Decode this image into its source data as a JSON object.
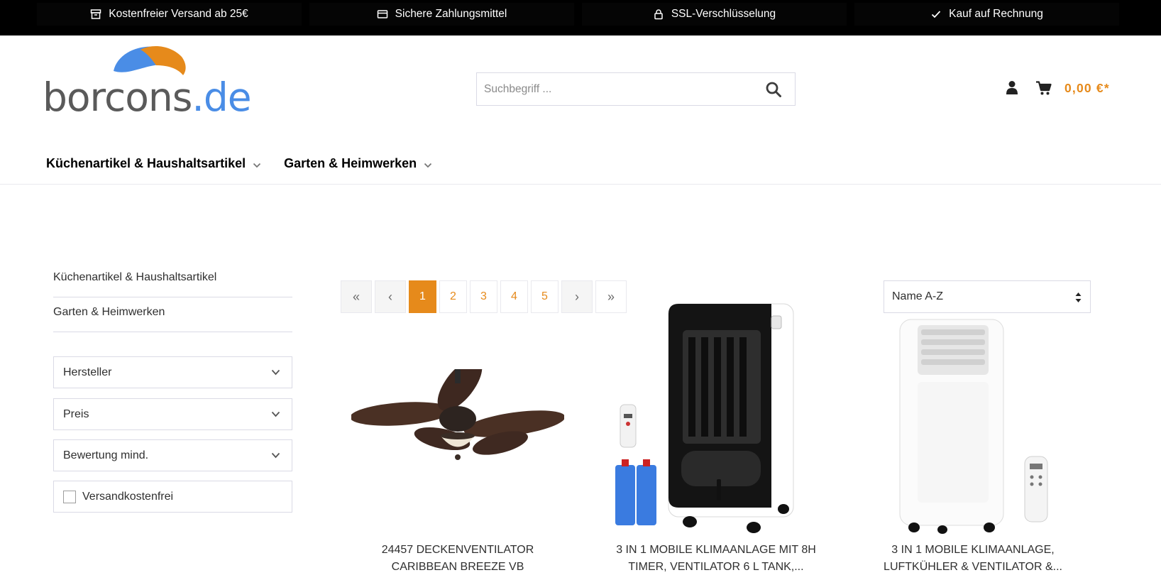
{
  "usp_bar": {
    "items": [
      {
        "icon": "archive-box-icon",
        "label": "Kostenfreier Versand ab 25€"
      },
      {
        "icon": "credit-card-icon",
        "label": "Sichere Zahlungsmittel"
      },
      {
        "icon": "lock-icon",
        "label": "SSL-Verschlüsselung"
      },
      {
        "icon": "checkmark-icon",
        "label": "Kauf auf Rechnung"
      }
    ]
  },
  "header": {
    "logo": {
      "part1": "borcons",
      "part2": ".de",
      "colors": {
        "text": "#5a5a5a",
        "tld": "#4a8de6",
        "swoosh_blue": "#4a8de6",
        "swoosh_orange": "#e68a1b"
      }
    },
    "search": {
      "placeholder": "Suchbegriff ...",
      "value": ""
    },
    "cart": {
      "amount": "0,00 €*"
    }
  },
  "main_nav": {
    "items": [
      {
        "label": "Küchenartikel & Haushaltsartikel"
      },
      {
        "label": "Garten & Heimwerken"
      }
    ]
  },
  "sidebar": {
    "categories": [
      {
        "label": "Küchenartikel & Haushaltsartikel"
      },
      {
        "label": "Garten & Heimwerken"
      }
    ],
    "filters": [
      {
        "label": "Hersteller"
      },
      {
        "label": "Preis"
      },
      {
        "label": "Bewertung mind."
      }
    ],
    "free_shipping": {
      "label": "Versandkostenfrei",
      "checked": false
    }
  },
  "listing": {
    "pagination": {
      "first": "«",
      "prev": "‹",
      "pages": [
        "1",
        "2",
        "3",
        "4",
        "5"
      ],
      "current": "1",
      "next": "›",
      "last": "»"
    },
    "sort": {
      "selected": "Name A-Z"
    },
    "products": [
      {
        "title_line1": "24457 DECKENVENTILATOR",
        "title_line2": "CARIBBEAN BREEZE VB"
      },
      {
        "title_line1": "3 IN 1 MOBILE KLIMAANLAGE MIT 8H",
        "title_line2": "TIMER, VENTILATOR 6 L TANK,..."
      },
      {
        "title_line1": "3 IN 1 MOBILE KLIMAANLAGE,",
        "title_line2": "LUFTKÜHLER & VENTILATOR &..."
      }
    ]
  },
  "colors": {
    "accent": "#e68a1b",
    "top_bar": "#000000",
    "border": "#dadae5"
  }
}
